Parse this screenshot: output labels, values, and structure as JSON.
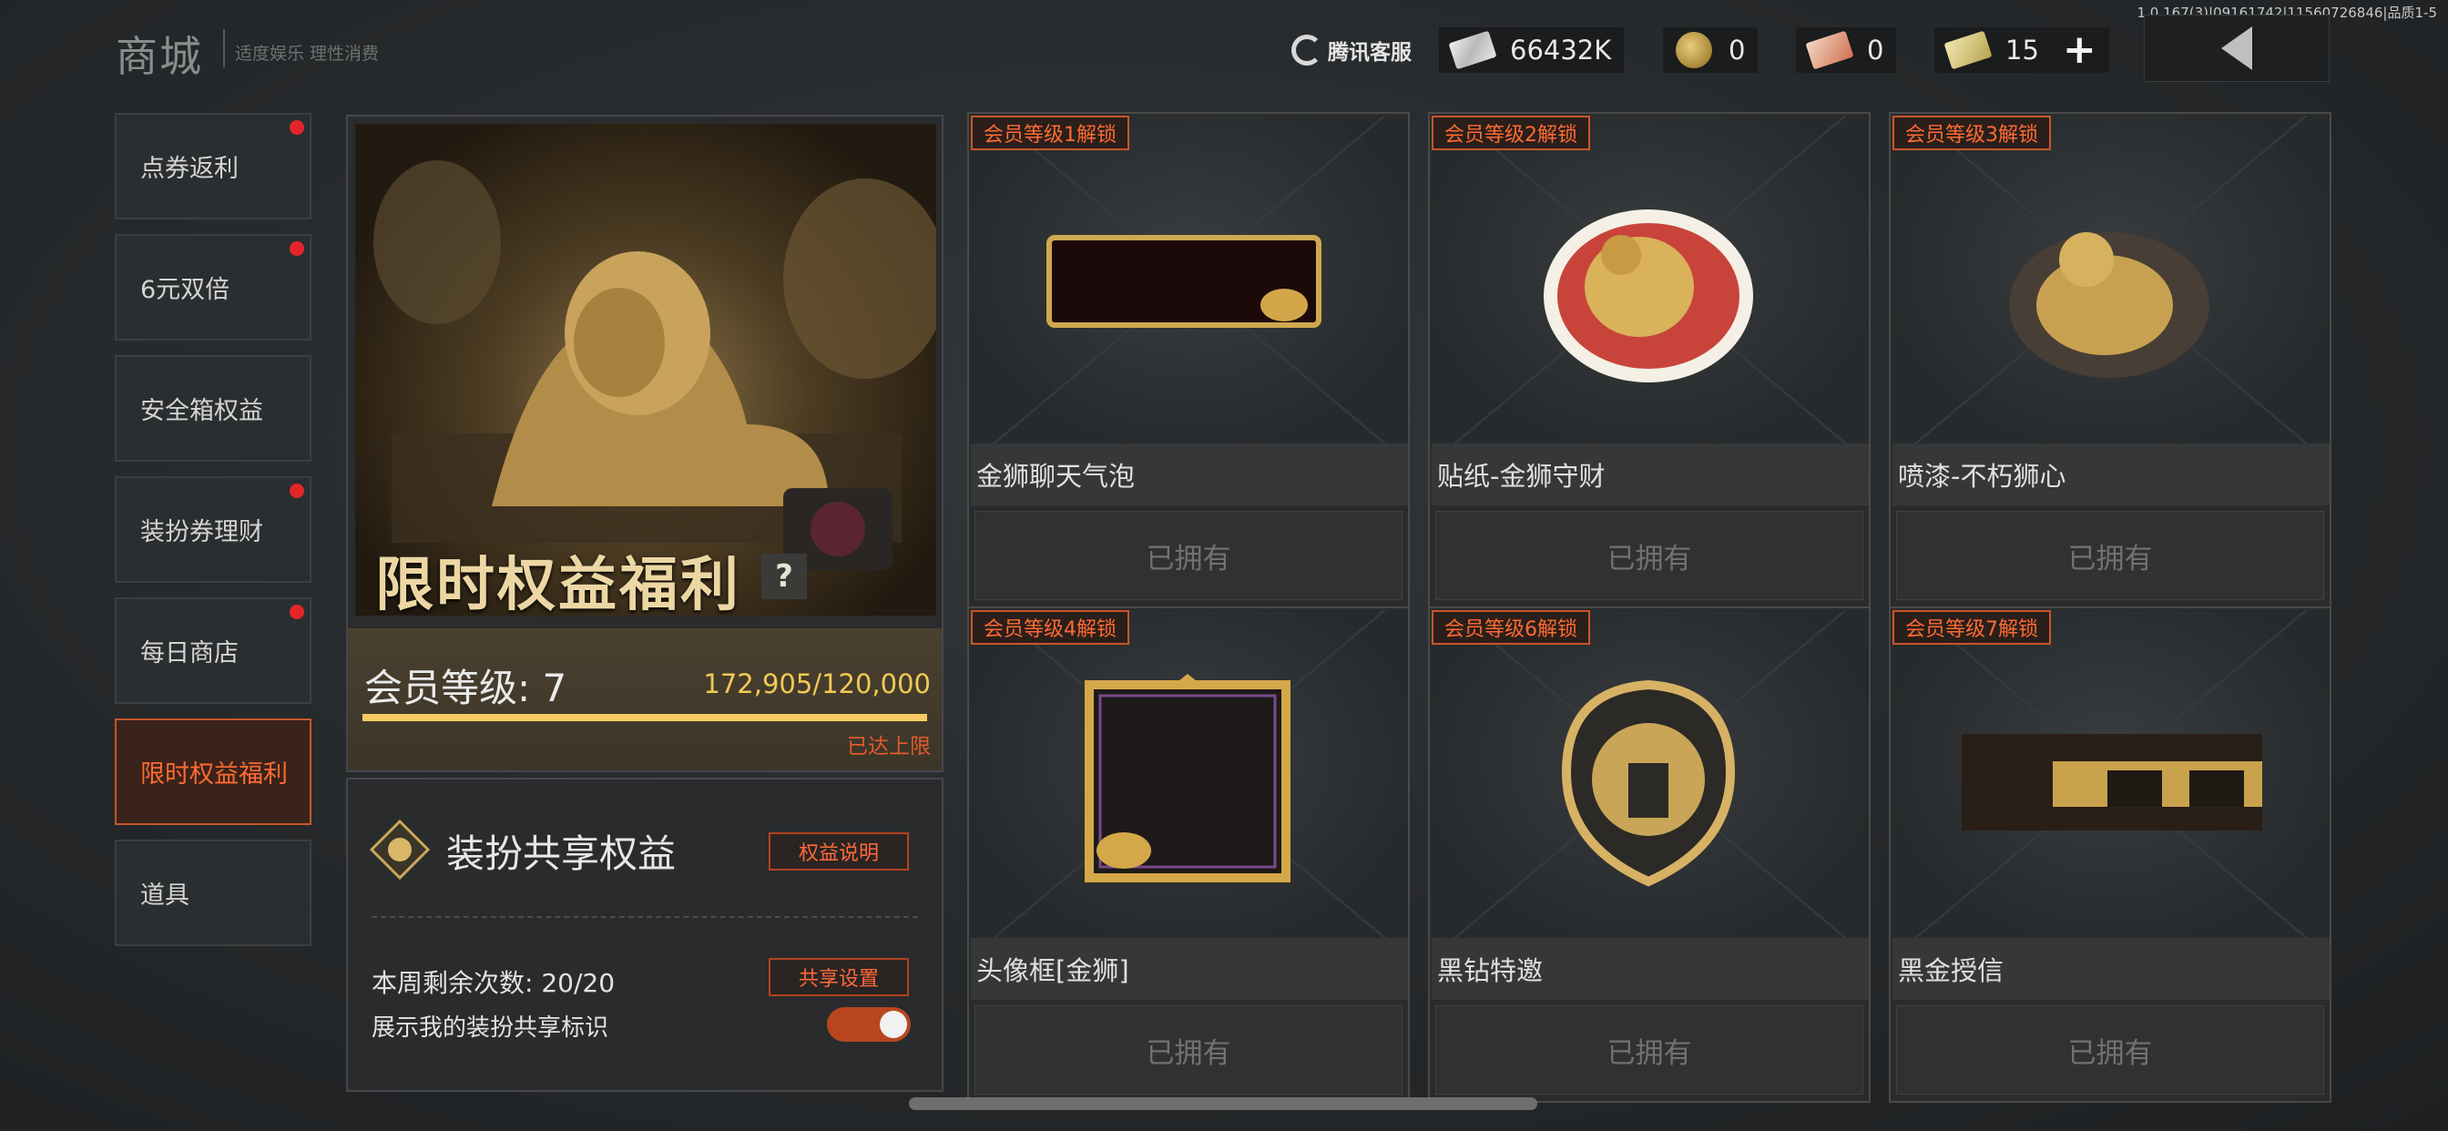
{
  "header": {
    "version": "1.0.167(3)|09161742|11560726846|品质1-5",
    "title": "商城",
    "subtitle": "适度娱乐 理性消费",
    "customer_service": "腾讯客服",
    "currencies": [
      {
        "icon": "banknote-icon",
        "value": "66432K"
      },
      {
        "icon": "coin-icon",
        "value": "0"
      },
      {
        "icon": "ticket-icon",
        "value": "0"
      },
      {
        "icon": "gold-bar-icon",
        "value": "15"
      }
    ],
    "add_symbol": "+"
  },
  "sidebar": {
    "items": [
      {
        "label": "点券返利",
        "dot": true
      },
      {
        "label": "6元双倍",
        "dot": true
      },
      {
        "label": "安全箱权益",
        "dot": false
      },
      {
        "label": "装扮券理财",
        "dot": true
      },
      {
        "label": "每日商店",
        "dot": true
      },
      {
        "label": "限时权益福利",
        "dot": false,
        "active": true
      },
      {
        "label": "道具",
        "dot": false
      }
    ]
  },
  "hero": {
    "title": "限时权益福利",
    "help": "?"
  },
  "member": {
    "label": "会员等级: 7",
    "progress_text": "172,905/120,000",
    "progress_fraction": 1.0,
    "max_text": "已达上限"
  },
  "share": {
    "title": "装扮共享权益",
    "explain_button": "权益说明",
    "weekly_text": "本周剩余次数: 20/20",
    "settings_button": "共享设置",
    "show_badge_text": "展示我的装扮共享标识",
    "show_badge_on": true
  },
  "items": [
    {
      "badge": "会员等级1解锁",
      "name": "金狮聊天气泡",
      "status": "已拥有"
    },
    {
      "badge": "会员等级2解锁",
      "name": "贴纸-金狮守财",
      "status": "已拥有"
    },
    {
      "badge": "会员等级3解锁",
      "name": "喷漆-不朽狮心",
      "status": "已拥有"
    },
    {
      "badge": "会员等级4解锁",
      "name": "头像框[金狮]",
      "status": "已拥有"
    },
    {
      "badge": "会员等级6解锁",
      "name": "黑钻特邀",
      "status": "已拥有"
    },
    {
      "badge": "会员等级7解锁",
      "name": "黑金授信",
      "status": "已拥有"
    }
  ],
  "colors": {
    "accent": "#ff6a33",
    "gold": "#f0ca55",
    "red_dot": "#e4262a"
  }
}
